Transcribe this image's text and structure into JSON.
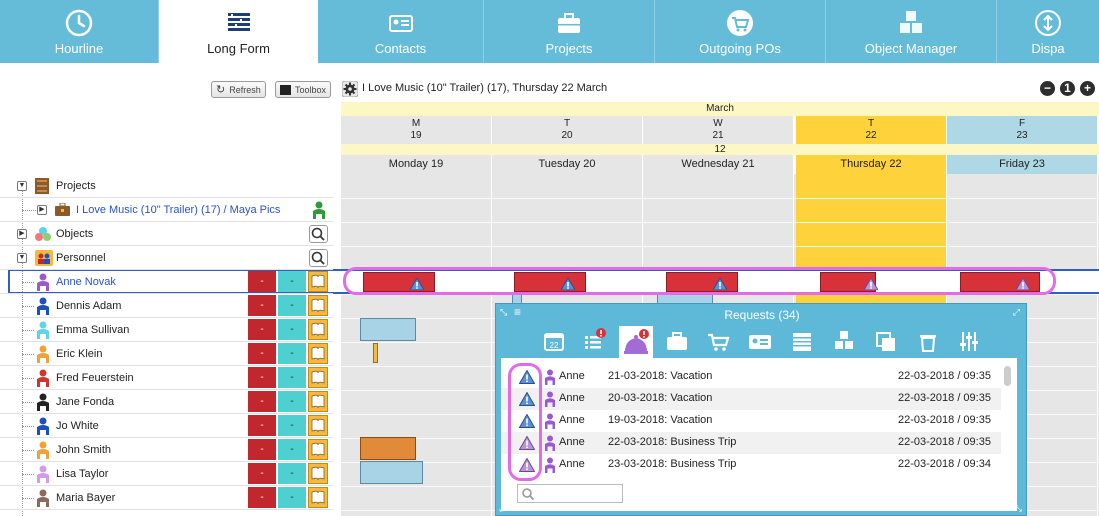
{
  "nav": {
    "tabs": [
      {
        "label": "Hourline",
        "icon": "clock-icon"
      },
      {
        "label": "Long Form",
        "icon": "longform-icon",
        "active": true
      },
      {
        "label": "Contacts",
        "icon": "contacts-icon"
      },
      {
        "label": "Projects",
        "icon": "briefcase-icon"
      },
      {
        "label": "Outgoing POs",
        "icon": "cart-icon"
      },
      {
        "label": "Object Manager",
        "icon": "cubes-icon"
      },
      {
        "label": "Dispa",
        "icon": "arrows-icon"
      }
    ]
  },
  "toolbar": {
    "refresh_label": "Refresh",
    "toolbox_label": "Toolbox",
    "context_title": "I Love Music (10\" Trailer) (17),  Thursday 22 March",
    "zoom_out": "−",
    "zoom_reset": "1",
    "zoom_in": "+"
  },
  "calendar": {
    "month": "March",
    "week": "12",
    "days": [
      {
        "letter": "M",
        "num": "19",
        "name": "Monday 19",
        "today": false
      },
      {
        "letter": "T",
        "num": "20",
        "name": "Tuesday 20",
        "today": false
      },
      {
        "letter": "W",
        "num": "21",
        "name": "Wednesday 21",
        "today": false
      },
      {
        "letter": "T",
        "num": "22",
        "name": "Thursday 22",
        "today": true
      },
      {
        "letter": "F",
        "num": "23",
        "name": "Friday 23",
        "today": false
      }
    ]
  },
  "tree": {
    "projects_label": "Projects",
    "project_item": "I Love Music (10\" Trailer) (17) / Maya Pics",
    "objects_label": "Objects",
    "personnel_label": "Personnel",
    "dash": "-",
    "people": [
      {
        "name": "Anne Novak",
        "color": "#9b59d0"
      },
      {
        "name": "Dennis Adam",
        "color": "#1f4fbf"
      },
      {
        "name": "Emma Sullivan",
        "color": "#5fd4e8"
      },
      {
        "name": "Eric Klein",
        "color": "#f0a23a"
      },
      {
        "name": "Fred Feuerstein",
        "color": "#d0342c"
      },
      {
        "name": "Jane Fonda",
        "color": "#222222"
      },
      {
        "name": "Jo White",
        "color": "#1f4fbf"
      },
      {
        "name": "John Smith",
        "color": "#f0a23a"
      },
      {
        "name": "Lisa Taylor",
        "color": "#d49be8"
      },
      {
        "name": "Maria Bayer",
        "color": "#8a6a5a"
      }
    ]
  },
  "requests": {
    "title": "Requests (34)",
    "rows": [
      {
        "who": "Anne",
        "text": "21-03-2018: Vacation",
        "date": "22-03-2018 / 09:35",
        "kind": "blue"
      },
      {
        "who": "Anne",
        "text": "20-03-2018: Vacation",
        "date": "22-03-2018 / 09:35",
        "kind": "blue"
      },
      {
        "who": "Anne",
        "text": "19-03-2018: Vacation",
        "date": "22-03-2018 / 09:35",
        "kind": "blue"
      },
      {
        "who": "Anne",
        "text": "22-03-2018: Business Trip",
        "date": "22-03-2018 / 09:35",
        "kind": "purple"
      },
      {
        "who": "Anne",
        "text": "23-03-2018: Business Trip",
        "date": "22-03-2018 / 09:34",
        "kind": "purple"
      }
    ],
    "search_placeholder": ""
  },
  "colors": {
    "nav_bg": "#65bcd9",
    "today_col": "#fdd23a",
    "friday_col": "#aed8e6",
    "request_bar": "#d7323a",
    "highlight": "#e36be8",
    "panel_bg": "#5eb8d8"
  }
}
